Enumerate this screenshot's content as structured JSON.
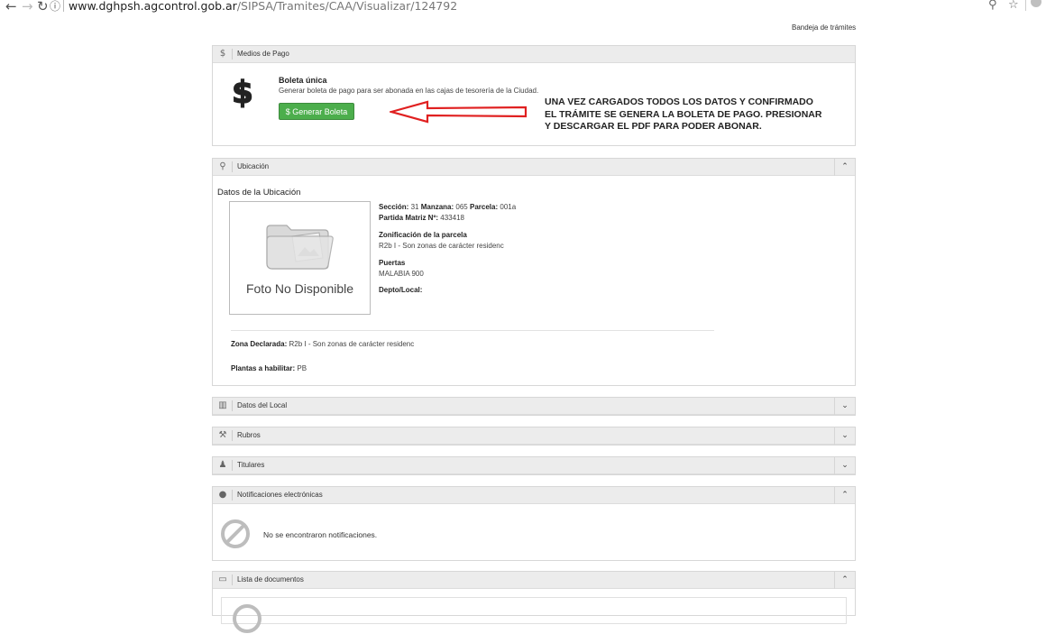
{
  "browser": {
    "url_host": "www.dghpsh.agcontrol.gob.ar",
    "url_path": "/SIPSA/Tramites/CAA/Visualizar/124792"
  },
  "top_link": "Bandeja de trámites",
  "medios_pago": {
    "title": "Medios de Pago",
    "icon": "dollar-icon",
    "boleta_title": "Boleta única",
    "boleta_desc": "Generar boleta de pago para ser abonada en las cajas de tesorería de la Ciudad.",
    "button_label": "$ Generar Boleta",
    "button_color": "#4cae4c",
    "annotation_lines": [
      "UNA VEZ CARGADOS TODOS LOS DATOS Y CONFIRMADO",
      "EL TRÁMITE SE GENERA LA BOLETA DE PAGO. PRESIONAR",
      "Y DESCARGAR EL PDF PARA PODER ABONAR."
    ],
    "arrow_color": "#e02020"
  },
  "ubicacion": {
    "title": "Ubicación",
    "icon": "map-pin-icon",
    "subtitle": "Datos de la Ubicación",
    "photo_caption": "Foto No Disponible",
    "seccion_label": "Sección:",
    "seccion_value": "31",
    "manzana_label": "Manzana:",
    "manzana_value": "065",
    "parcela_label": "Parcela:",
    "parcela_value": "001a",
    "partida_label": "Partida Matriz Nº:",
    "partida_value": "433418",
    "zonificacion_label": "Zonificación de la parcela",
    "zonificacion_value": "R2b I - Son zonas de carácter residenc",
    "puertas_label": "Puertas",
    "puertas_value": "MALABIA 900",
    "depto_label": "Depto/Local:",
    "zona_label": "Zona Declarada:",
    "zona_value": "R2b I - Son zonas de carácter residenc",
    "plantas_label": "Plantas a habilitar:",
    "plantas_value": "PB"
  },
  "datos_local": {
    "title": "Datos del Local",
    "icon": "building-icon"
  },
  "rubros": {
    "title": "Rubros",
    "icon": "hammer-icon"
  },
  "titulares": {
    "title": "Titulares",
    "icon": "users-icon"
  },
  "notificaciones": {
    "title": "Notificaciones electrónicas",
    "icon": "comment-icon",
    "empty_text": "No se encontraron notificaciones."
  },
  "documentos": {
    "title": "Lista de documentos",
    "icon": "list-icon"
  }
}
